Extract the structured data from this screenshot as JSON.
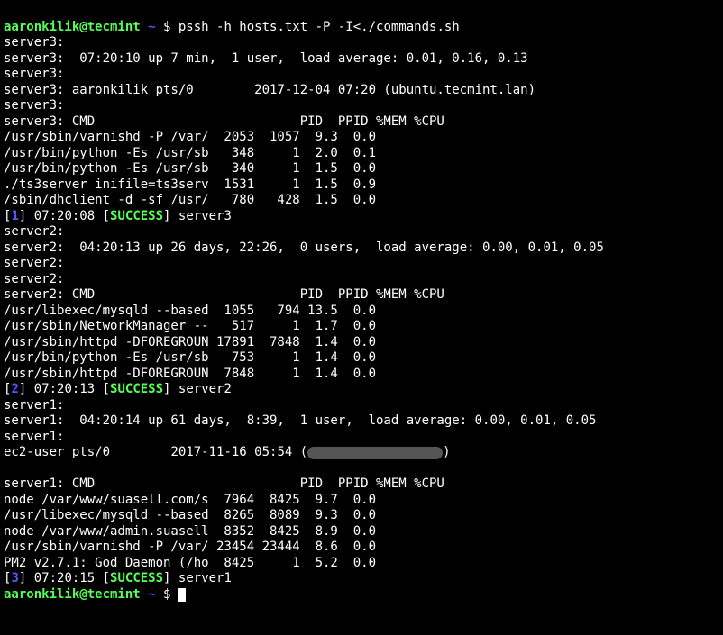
{
  "prompt": {
    "user": "aaronkilik@tecmint ",
    "dir": "~ ",
    "cmd1": "$ pssh -h hosts.txt -P -I<./commands.sh",
    "dollar": "$ "
  },
  "s3": {
    "l1": "server3:",
    "l2": "server3:  07:20:10 up 7 min,  1 user,  load average: 0.01, 0.16, 0.13",
    "l3": "server3:",
    "l4": "server3: aaronkilik pts/0        2017-12-04 07:20 (ubuntu.tecmint.lan)",
    "l5": "server3:",
    "l6": "server3: CMD                           PID  PPID %MEM %CPU",
    "p0": "/usr/sbin/varnishd -P /var/  2053  1057  9.3  0.0",
    "p1": "/usr/bin/python -Es /usr/sb   348     1  2.0  0.1",
    "p2": "/usr/bin/python -Es /usr/sb   340     1  1.5  0.0",
    "p3": "./ts3server inifile=ts3serv  1531     1  1.5  0.9",
    "p4": "/sbin/dhclient -d -sf /usr/   780   428  1.5  0.0"
  },
  "r1": {
    "n": "1",
    "t": "07:20:08",
    "s": "SUCCESS",
    "h": "server3"
  },
  "s2": {
    "l1": "server2:",
    "l2": "server2:  04:20:13 up 26 days, 22:26,  0 users,  load average: 0.00, 0.01, 0.05",
    "l3": "server2:",
    "l4": "server2:",
    "l5": "server2: CMD                           PID  PPID %MEM %CPU",
    "p0": "/usr/libexec/mysqld --based  1055   794 13.5  0.0",
    "p1": "/usr/sbin/NetworkManager --   517     1  1.7  0.0",
    "p2": "/usr/sbin/httpd -DFOREGROUN 17891  7848  1.4  0.0",
    "p3": "/usr/bin/python -Es /usr/sb   753     1  1.4  0.0",
    "p4": "/usr/sbin/httpd -DFOREGROUN  7848     1  1.4  0.0"
  },
  "r2": {
    "n": "2",
    "t": "07:20:13",
    "s": "SUCCESS",
    "h": "server2"
  },
  "s1": {
    "l1": "server1:",
    "l2": "server1:  04:20:14 up 61 days,  8:39,  1 user,  load average: 0.00, 0.01, 0.05",
    "l3": "server1:",
    "l4a": "ec2-user pts/0        ",
    "l4b": "2017-11-16 05:54 (",
    "l4c": ")",
    "blank": " ",
    "l5": "server1: CMD                           PID  PPID %MEM %CPU",
    "p0": "node /var/www/suasell.com/s  7964  8425  9.7  0.0",
    "p1": "/usr/libexec/mysqld --based  8265  8089  9.3  0.0",
    "p2": "node /var/www/admin.suasell  8352  8425  8.9  0.0",
    "p3": "/usr/sbin/varnishd -P /var/ 23454 23444  8.6  0.0",
    "p4": "PM2 v2.7.1: God Daemon (/ho  8425     1  5.2  0.0"
  },
  "r3": {
    "n": "3",
    "t": "07:20:15",
    "s": "SUCCESS",
    "h": "server1"
  }
}
